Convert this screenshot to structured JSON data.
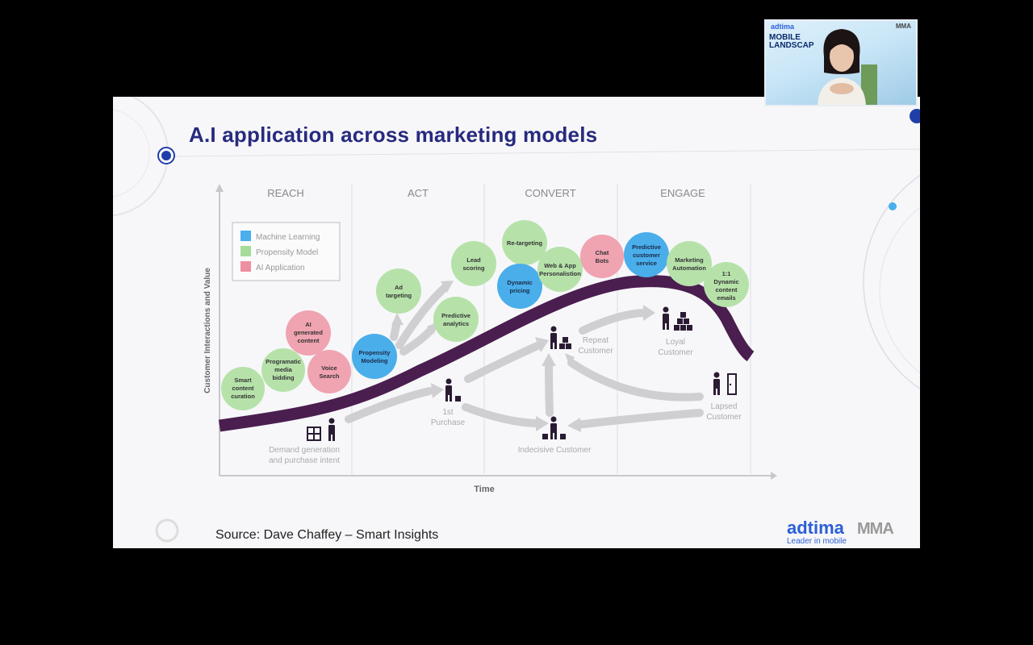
{
  "slide": {
    "title": "A.I application across marketing models",
    "source": "Source: Dave Chaffey – Smart Insights",
    "brand": "adtima",
    "brand_tagline": "Leader in mobile",
    "partner_logo": "MMA"
  },
  "diagram": {
    "stages": [
      "REACH",
      "ACT",
      "CONVERT",
      "ENGAGE"
    ],
    "y_axis_label": "Customer Interactions and Value",
    "x_axis_label": "Time",
    "legend": [
      {
        "label": "Machine Learning",
        "color": "#4aaeea"
      },
      {
        "label": "Propensity Model",
        "color": "#a6dc9a"
      },
      {
        "label": "AI Application",
        "color": "#ee8fa0"
      }
    ],
    "bubbles": [
      {
        "lines": [
          "Smart",
          "content",
          "curation"
        ]
      },
      {
        "lines": [
          "Programatic",
          "media",
          "bidding"
        ]
      },
      {
        "lines": [
          "AI",
          "generated",
          "content"
        ]
      },
      {
        "lines": [
          "Voice",
          "Search"
        ]
      },
      {
        "lines": [
          "Propensity",
          "Modeling"
        ]
      },
      {
        "lines": [
          "Ad",
          "targeting"
        ]
      },
      {
        "lines": [
          "Predictive",
          "analytics"
        ]
      },
      {
        "lines": [
          "Lead",
          "scoring"
        ]
      },
      {
        "lines": [
          "Re-targeting"
        ]
      },
      {
        "lines": [
          "Dynamic",
          "pricing"
        ]
      },
      {
        "lines": [
          "Web & App",
          "Personalistion"
        ]
      },
      {
        "lines": [
          "Chat",
          "Bots"
        ]
      },
      {
        "lines": [
          "Predictive",
          "customer",
          "service"
        ]
      },
      {
        "lines": [
          "Marketing",
          "Automation"
        ]
      },
      {
        "lines": [
          "1:1",
          "Dynamic",
          "content",
          "emails"
        ]
      }
    ],
    "customer_labels": [
      {
        "lines": [
          "Demand generation",
          "and purchase intent"
        ]
      },
      {
        "lines": [
          "1st",
          "Purchase"
        ]
      },
      {
        "lines": [
          "Repeat",
          "Customer"
        ]
      },
      {
        "lines": [
          "Loyal",
          "Customer"
        ]
      },
      {
        "lines": [
          "Lapsed",
          "Customer"
        ]
      },
      {
        "lines": [
          "Indecisive Customer"
        ]
      }
    ],
    "colors": {
      "curve": "#4a1e4f",
      "arrow": "#cfcfd2",
      "figure": "#2a1b33"
    }
  },
  "webcam": {
    "brand": "adtima",
    "title_line1": "MOBILE",
    "title_line2": "LANDSCAP",
    "partner": "MMA"
  }
}
